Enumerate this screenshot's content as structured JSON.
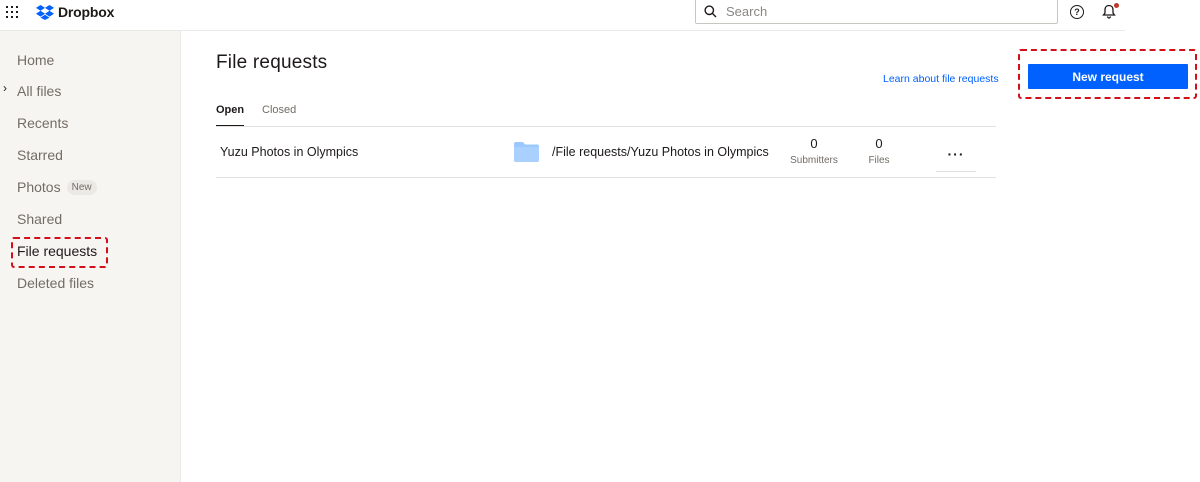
{
  "header": {
    "app_name": "Dropbox",
    "search_placeholder": "Search",
    "help_glyph": "?",
    "icons": [
      "apps-grid-icon",
      "dropbox-logo",
      "search-icon",
      "help-icon",
      "bell-icon"
    ],
    "notification_dot_color": "#c0362c"
  },
  "sidebar": {
    "items": [
      {
        "label": "Home"
      },
      {
        "label": "All files"
      },
      {
        "label": "Recents"
      },
      {
        "label": "Starred"
      },
      {
        "label": "Photos",
        "badge": "New"
      },
      {
        "label": "Shared"
      },
      {
        "label": "File requests",
        "active": true
      },
      {
        "label": "Deleted files"
      }
    ],
    "expand_glyph": "›"
  },
  "main": {
    "title": "File requests",
    "learn_link": "Learn about file requests",
    "new_request_label": "New request",
    "tabs": [
      {
        "label": "Open",
        "active": true
      },
      {
        "label": "Closed"
      }
    ],
    "requests": [
      {
        "name": "Yuzu Photos in Olympics",
        "path": "/File requests/Yuzu Photos in Olympics",
        "submitters": "0",
        "submitters_label": "Submitters",
        "files": "0",
        "files_label": "Files",
        "more_glyph": "···"
      }
    ]
  },
  "colors": {
    "accent": "#0061fe",
    "highlight": "#d3101a",
    "sidebar_bg": "#f7f5f2",
    "folder": "#9ac8ff"
  }
}
